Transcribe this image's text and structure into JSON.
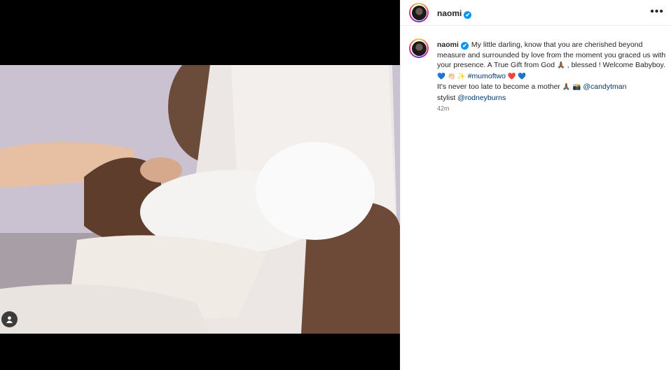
{
  "post": {
    "username": "naomi",
    "verified_mark": "✔",
    "more_icon": "•••",
    "caption": {
      "line1_text": "My little darling, know that you are cherished beyond measure and surrounded by love from the moment you graced us with your presence. A True Gift from God ",
      "praying_emoji": "🙏🏾",
      "line1_text2": " , blessed ! Welcome Babyboy. ",
      "emojis1": "💙 👏🏻 ✨",
      "hashtag": "#mumoftwo",
      "emojis2": "❤️ 💙",
      "line2_text": "It's never too late to become a mother ",
      "camera_emoji": "📸",
      "mention1": "@candytman",
      "line3_text": "stylist ",
      "mention2": "@rodneyburns"
    },
    "timestamp": "42m",
    "icons": {
      "tag": "user-tag-icon",
      "verified": "verified-badge-icon",
      "more": "more-options-icon"
    }
  }
}
